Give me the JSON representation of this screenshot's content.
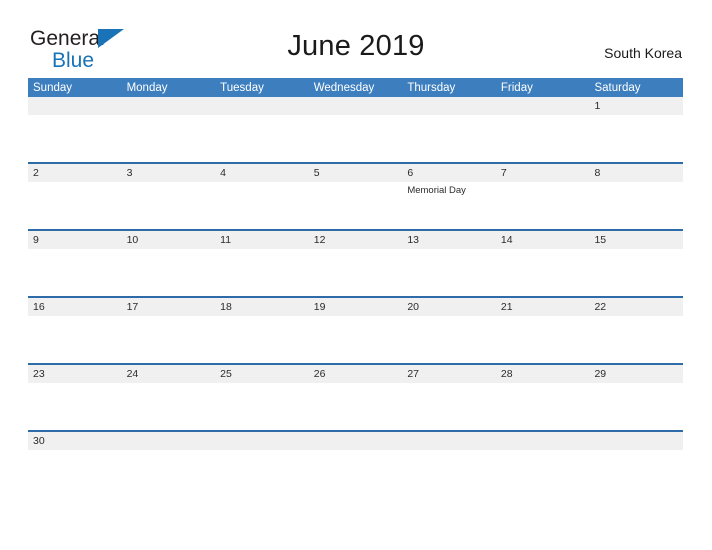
{
  "logo": {
    "word1": "General",
    "word2": "Blue",
    "triangle_icon": "triangle-icon",
    "color_dark": "#231f20",
    "color_blue": "#1a73b7"
  },
  "header": {
    "title": "June 2019",
    "country": "South Korea"
  },
  "colors": {
    "header_blue": "#3d7ebf",
    "separator_blue": "#2d6ca8",
    "date_band_gray": "#f0f0f0",
    "text_dark": "#2b2b2b",
    "page_background": "#ffffff"
  },
  "calendar": {
    "month": "June",
    "year": "2019",
    "weekday_headers": [
      "Sunday",
      "Monday",
      "Tuesday",
      "Wednesday",
      "Thursday",
      "Friday",
      "Saturday"
    ],
    "weeks": [
      {
        "days": [
          {
            "number": "",
            "events": []
          },
          {
            "number": "",
            "events": []
          },
          {
            "number": "",
            "events": []
          },
          {
            "number": "",
            "events": []
          },
          {
            "number": "",
            "events": []
          },
          {
            "number": "",
            "events": []
          },
          {
            "number": "1",
            "events": []
          }
        ]
      },
      {
        "days": [
          {
            "number": "2",
            "events": []
          },
          {
            "number": "3",
            "events": []
          },
          {
            "number": "4",
            "events": []
          },
          {
            "number": "5",
            "events": []
          },
          {
            "number": "6",
            "events": [
              "Memorial Day"
            ]
          },
          {
            "number": "7",
            "events": []
          },
          {
            "number": "8",
            "events": []
          }
        ]
      },
      {
        "days": [
          {
            "number": "9",
            "events": []
          },
          {
            "number": "10",
            "events": []
          },
          {
            "number": "11",
            "events": []
          },
          {
            "number": "12",
            "events": []
          },
          {
            "number": "13",
            "events": []
          },
          {
            "number": "14",
            "events": []
          },
          {
            "number": "15",
            "events": []
          }
        ]
      },
      {
        "days": [
          {
            "number": "16",
            "events": []
          },
          {
            "number": "17",
            "events": []
          },
          {
            "number": "18",
            "events": []
          },
          {
            "number": "19",
            "events": []
          },
          {
            "number": "20",
            "events": []
          },
          {
            "number": "21",
            "events": []
          },
          {
            "number": "22",
            "events": []
          }
        ]
      },
      {
        "days": [
          {
            "number": "23",
            "events": []
          },
          {
            "number": "24",
            "events": []
          },
          {
            "number": "25",
            "events": []
          },
          {
            "number": "26",
            "events": []
          },
          {
            "number": "27",
            "events": []
          },
          {
            "number": "28",
            "events": []
          },
          {
            "number": "29",
            "events": []
          }
        ]
      },
      {
        "days": [
          {
            "number": "30",
            "events": []
          },
          {
            "number": "",
            "events": []
          },
          {
            "number": "",
            "events": []
          },
          {
            "number": "",
            "events": []
          },
          {
            "number": "",
            "events": []
          },
          {
            "number": "",
            "events": []
          },
          {
            "number": "",
            "events": []
          }
        ]
      }
    ]
  }
}
